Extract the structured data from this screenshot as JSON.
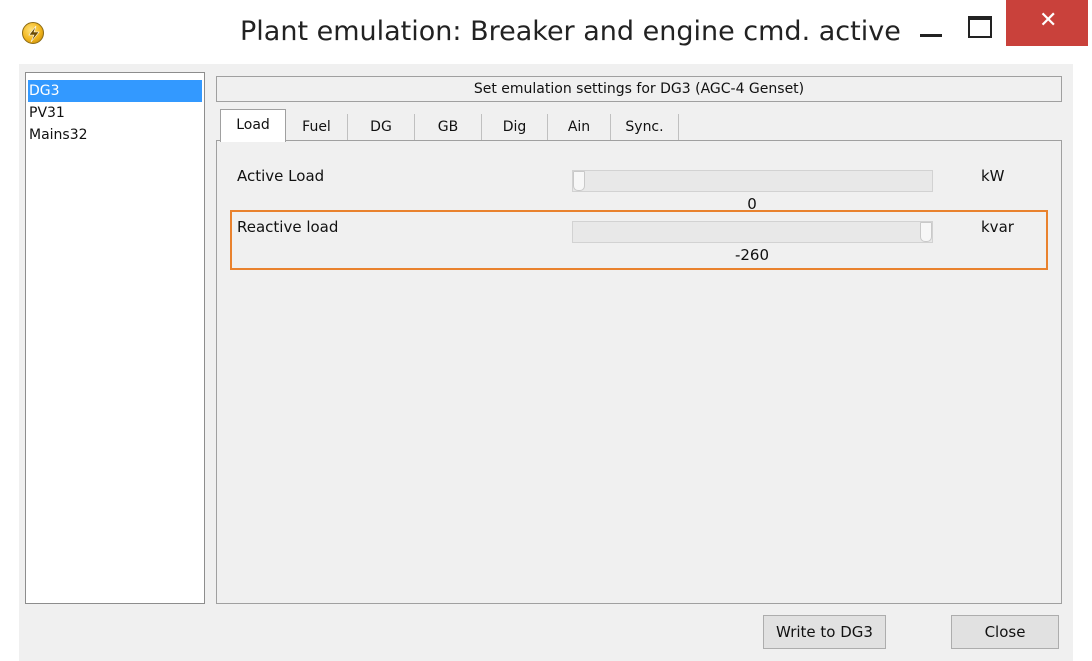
{
  "window": {
    "title": "Plant emulation: Breaker and engine cmd. active",
    "app_icon": "lightning-bolt-icon",
    "close_glyph": "✕"
  },
  "device_list": {
    "items": [
      {
        "label": "DG3",
        "selected": true
      },
      {
        "label": "PV31",
        "selected": false
      },
      {
        "label": "Mains32",
        "selected": false
      }
    ]
  },
  "header": {
    "text": "Set emulation settings for DG3 (AGC-4 Genset)"
  },
  "tabs": [
    {
      "label": "Load",
      "active": true
    },
    {
      "label": "Fuel",
      "active": false
    },
    {
      "label": "DG",
      "active": false
    },
    {
      "label": "GB",
      "active": false
    },
    {
      "label": "Dig",
      "active": false
    },
    {
      "label": "Ain",
      "active": false
    },
    {
      "label": "Sync.",
      "active": false
    }
  ],
  "load": {
    "active": {
      "label": "Active Load",
      "value": "0",
      "unit": "kW",
      "slider_fraction": 0.0
    },
    "reactive": {
      "label": "Reactive load",
      "value": "-260",
      "unit": "kvar",
      "slider_fraction": 1.0
    }
  },
  "buttons": {
    "write": "Write to DG3",
    "close": "Close"
  },
  "colors": {
    "selection": "#3399ff",
    "close_button": "#c9413b",
    "highlight": "#e9822e"
  }
}
